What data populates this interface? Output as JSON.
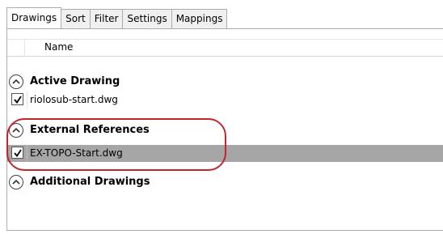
{
  "tabs": [
    {
      "label": "Drawings",
      "active": true
    },
    {
      "label": "Sort",
      "active": false
    },
    {
      "label": "Filter",
      "active": false
    },
    {
      "label": "Settings",
      "active": false
    },
    {
      "label": "Mappings",
      "active": false
    }
  ],
  "columns": {
    "name": "Name"
  },
  "groups": [
    {
      "label": "Active Drawing",
      "expander_icon": "chevron-up-icon",
      "items": [
        {
          "filename": "riolosub-start.dwg",
          "checked": true,
          "selected": false
        }
      ]
    },
    {
      "label": "External References",
      "expander_icon": "chevron-up-icon",
      "items": [
        {
          "filename": "EX-TOPO-Start.dwg",
          "checked": true,
          "selected": true
        }
      ]
    },
    {
      "label": "Additional Drawings",
      "expander_icon": "chevron-up-icon",
      "items": []
    }
  ],
  "colors": {
    "selected_row": "#a6a6a6",
    "annotation_outline": "#c0272d"
  }
}
